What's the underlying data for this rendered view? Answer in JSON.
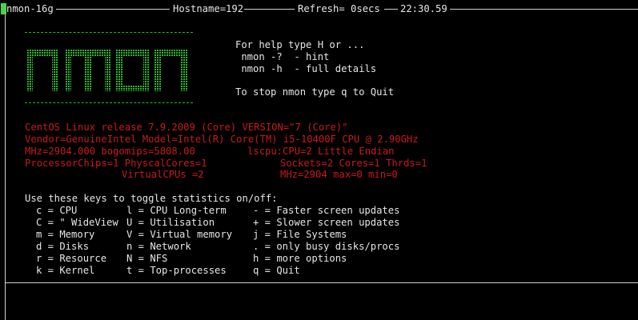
{
  "header": {
    "title": "nmon-16g",
    "hostname": "Hostname=192",
    "refresh": "Refresh= 0secs",
    "time": "22:30.59"
  },
  "logo": {
    "text": "nmon",
    "color": "#2fb52f"
  },
  "help": {
    "line1": "For help type H or ...",
    "line2": " nmon -?  - hint",
    "line3": " nmon -h  - full details",
    "line4": "To stop nmon type q to Quit"
  },
  "system": {
    "release": "CentOS Linux release 7.9.2009 (Core) VERSION=\"7 (Core)\"",
    "vendor": "Vendor=GenuineIntel Model=Intel(R) Core(TM) i5-10400F CPU @ 2.90GHz",
    "mhz": "MHz=2904.000 bogomips=5808.00",
    "lscpu": "lscpu:CPU=2 Little Endian",
    "chips": "ProcessorChips=1 PhyscalCores=1",
    "sockets": "Sockets=2 Cores=1 Thrds=1",
    "vcpus": "VirtualCPUs =2",
    "mhzmax": "MHz=2904 max=0 min=0",
    "color": "#c8191c"
  },
  "keys": {
    "intro": "Use these keys to toggle statistics on/off:",
    "rows": [
      [
        "c = CPU",
        "l = CPU Long-term",
        "- = Faster screen updates"
      ],
      [
        "C = \" WideView",
        "U = Utilisation",
        "+ = Slower screen updates"
      ],
      [
        "m = Memory",
        "V = Virtual memory",
        "j = File Systems"
      ],
      [
        "d = Disks",
        "n = Network",
        ". = only busy disks/procs"
      ],
      [
        "r = Resource",
        "N = NFS",
        "h = more options"
      ],
      [
        "k = Kernel",
        "t = Top-processes",
        "q = Quit"
      ]
    ]
  }
}
